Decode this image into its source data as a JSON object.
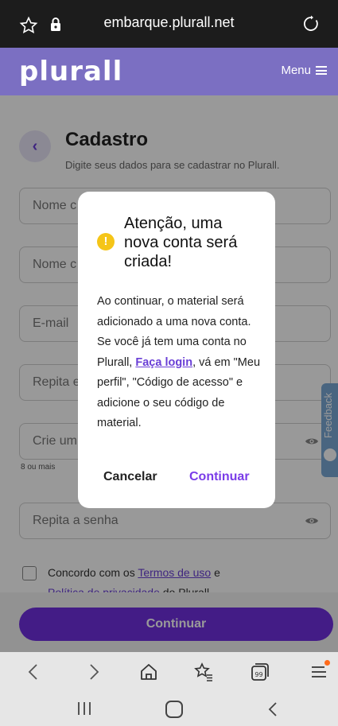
{
  "browser": {
    "url": "embarque.plurall.net"
  },
  "header": {
    "logo": "plurall",
    "menu_label": "Menu"
  },
  "page": {
    "title": "Cadastro",
    "subtitle": "Digite seus dados para se cadastrar no Plurall.",
    "fields": [
      {
        "placeholder": "Nome c"
      },
      {
        "placeholder": "Nome c"
      },
      {
        "placeholder": "E-mail"
      },
      {
        "placeholder": "Repita e"
      },
      {
        "placeholder": "Crie um"
      },
      {
        "placeholder": "Repita a senha"
      }
    ],
    "password_hint": "8 ou mais",
    "terms": {
      "prefix": "Concordo com os ",
      "terms_link": "Termos de uso",
      "middle": " e",
      "privacy_link": "Política de privacidade",
      "suffix": " do Plurall"
    },
    "continue_button": "Continuar",
    "feedback_label": "Feedback"
  },
  "modal": {
    "title": "Atenção, uma nova conta será criada!",
    "body_1": "Ao continuar, o material será adicionado a uma nova conta. Se você já tem uma conta no Plurall,",
    "login_link": "Faça login",
    "body_2": ", vá em \"Meu perfil\", \"Código de acesso\" e adicione o seu código de material.",
    "cancel": "Cancelar",
    "confirm": "Continuar"
  },
  "colors": {
    "brand_purple": "#7030e0",
    "header_purple": "#7b6fc2",
    "warning_yellow": "#f5c518",
    "notification_orange": "#ff6a1a"
  },
  "icons": [
    "star-icon",
    "lock-icon",
    "reload-icon",
    "menu-icon",
    "back-icon",
    "eye-icon",
    "warning-icon",
    "smile-icon",
    "nav-back-icon",
    "nav-forward-icon",
    "home-icon",
    "bookmark-icon",
    "tabs-icon",
    "hamburger-icon",
    "android-recent-icon",
    "android-home-icon",
    "android-back-icon"
  ]
}
